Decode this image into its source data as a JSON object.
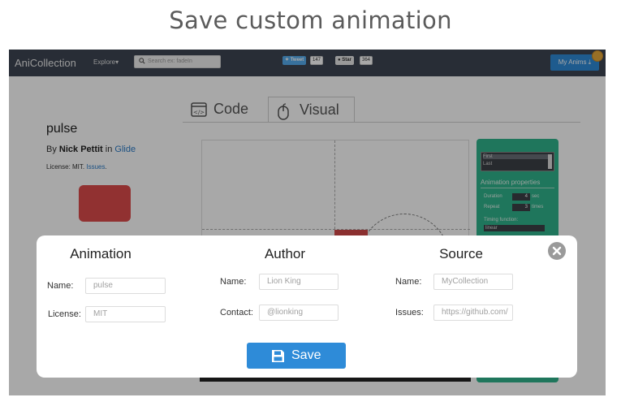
{
  "headline": "Save custom animation",
  "navbar": {
    "brand": "AniCollection",
    "explore": "Explore",
    "search_placeholder": "Search ex: fadeIn",
    "tweet_label": "Tweet",
    "tweet_count": "147",
    "star_label": "Star",
    "star_count": "364",
    "my_anims": "My Anims"
  },
  "tabs": {
    "code": "Code",
    "visual": "Visual"
  },
  "animation": {
    "name": "pulse",
    "by_prefix": "By",
    "author": "Nick Pettit",
    "in_word": "in",
    "collection": "Glide",
    "license_prefix": "License: MIT.",
    "issues": "Issues",
    "license_suffix": "."
  },
  "panel": {
    "keyframes": [
      "First",
      "Last"
    ],
    "props_title": "Animation properties",
    "duration_label": "Duration",
    "duration_value": "4",
    "duration_unit": "sec",
    "repeat_label": "Repeat",
    "repeat_value": "3",
    "repeat_unit": "times",
    "timing_label": "Timing function:",
    "timing_value": "linear"
  },
  "modal": {
    "animation": {
      "heading": "Animation",
      "name_label": "Name:",
      "name_placeholder": "pulse",
      "license_label": "License:",
      "license_placeholder": "MIT"
    },
    "author": {
      "heading": "Author",
      "name_label": "Name:",
      "name_placeholder": "Lion King",
      "contact_label": "Contact:",
      "contact_placeholder": "@lionking"
    },
    "source": {
      "heading": "Source",
      "name_label": "Name:",
      "name_placeholder": "MyCollection",
      "issues_label": "Issues:",
      "issues_placeholder": "https://github.com/"
    },
    "save_label": "Save"
  },
  "colors": {
    "accent": "#2e8bd8",
    "navbar": "#3d4553",
    "panel": "#2fb38c",
    "demo_red": "#dd4b4b"
  }
}
